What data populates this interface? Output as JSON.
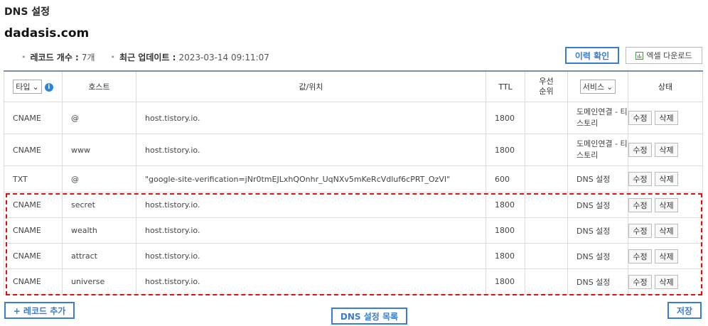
{
  "page_title": "DNS 설정",
  "domain": "dadasis.com",
  "meta": {
    "record_count_label": "레코드 개수 :",
    "record_count_value": "7개",
    "updated_label": "최근 업데이트 :",
    "updated_value": "2023-03-14 09:11:07"
  },
  "buttons": {
    "history": "이력 확인",
    "excel": "엑셀 다운로드",
    "add_record": "+ 레코드 추가",
    "dns_list": "DNS 설정 목록",
    "save": "저장"
  },
  "table": {
    "headers": {
      "type_select": "타입",
      "host": "호스트",
      "value": "값/위치",
      "ttl": "TTL",
      "priority": "우선\n순위",
      "service_select": "서비스",
      "status": "상태"
    },
    "rows": [
      {
        "type": "CNAME",
        "host": "@",
        "value": "host.tistory.io.",
        "ttl": "1800",
        "priority": "",
        "service": "도메인연결 - 티스토리"
      },
      {
        "type": "CNAME",
        "host": "www",
        "value": "host.tistory.io.",
        "ttl": "1800",
        "priority": "",
        "service": "도메인연결 - 티스토리"
      },
      {
        "type": "TXT",
        "host": "@",
        "value": "\"google-site-verification=jNr0tmEJLxhQOnhr_UqNXv5mKeRcVdluf6cPRT_OzVI\"",
        "ttl": "600",
        "priority": "",
        "service": "DNS 설정"
      },
      {
        "type": "CNAME",
        "host": "secret",
        "value": "host.tistory.io.",
        "ttl": "1800",
        "priority": "",
        "service": "DNS 설정"
      },
      {
        "type": "CNAME",
        "host": "wealth",
        "value": "host.tistory.io.",
        "ttl": "1800",
        "priority": "",
        "service": "DNS 설정"
      },
      {
        "type": "CNAME",
        "host": "attract",
        "value": "host.tistory.io.",
        "ttl": "1800",
        "priority": "",
        "service": "DNS 설정"
      },
      {
        "type": "CNAME",
        "host": "universe",
        "value": "host.tistory.io.",
        "ttl": "1800",
        "priority": "",
        "service": "DNS 설정"
      }
    ],
    "edit_label": "수정",
    "delete_label": "삭제"
  },
  "colors": {
    "accent": "#3a7bd5",
    "highlight": "#dd1111",
    "info": "#2a86d9"
  }
}
